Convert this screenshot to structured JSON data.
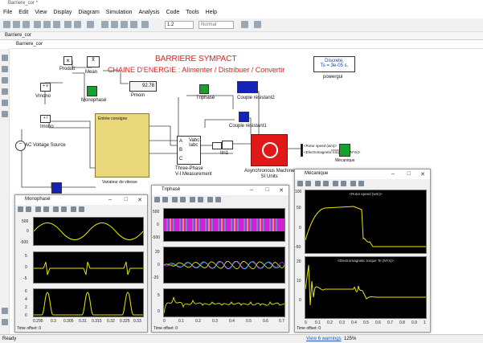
{
  "window": {
    "title": "Barriere_cor *"
  },
  "menu": [
    "File",
    "Edit",
    "View",
    "Display",
    "Diagram",
    "Simulation",
    "Analysis",
    "Code",
    "Tools",
    "Help"
  ],
  "toolbar": {
    "step_time": "1.2",
    "sim_mode": "Normal"
  },
  "tab": {
    "label": "Barriere_cor"
  },
  "breadcrumb": {
    "label": "Barriere_cor"
  },
  "model": {
    "title": "BARRIERE SYMPACT",
    "subtitle": "CHAINE D'ENERGIE : Alimenter / Distribuer / Convertir",
    "title_color": "#e02020",
    "powergui": {
      "text1": "Discrete,",
      "text2": "Ts = 3e-05 s.",
      "label": "powergui"
    },
    "blocks": {
      "produit": "Produit",
      "mean": "Mean",
      "display_value": "92.78",
      "pmoin": "Pmoin",
      "vmono": "Vmono",
      "imono": "Imono",
      "monophase": "Monophasé",
      "ac_source": "AC Voltage Source",
      "variateur": "Variateur de vitesse",
      "variateur_ports": "Entrée consigne",
      "triphase": "Triphasé",
      "vi_meas": "Three-Phase\nV-I Measurement",
      "vi_ports_left": [
        "A",
        "B",
        "C"
      ],
      "vi_ports_right": [
        "Vabc",
        "Iabc",
        "a",
        "b",
        "c"
      ],
      "itri1": "Itri1",
      "couple_resistant2": "Couple résistant2",
      "couple_resistant1": "Couple résistant1",
      "motor": "Asynchronous Machine\nSI Units",
      "bus_sel_1": "<Rotor speed (wm)>",
      "bus_sel_2": "<Electromagnetic torque Te (N*m)>",
      "mecanique": "Mécanique"
    }
  },
  "scopes": {
    "monophase": {
      "title": "Monophasé",
      "time_offset": "Time offset:  0",
      "y_ticks_1": [
        "500",
        "0",
        "-500"
      ],
      "y_ticks_2": [
        "5",
        "0",
        "-5"
      ],
      "y_ticks_3": [
        "6",
        "4",
        "2",
        "0"
      ],
      "x_ticks": [
        "0.295",
        "0.3",
        "0.305",
        "0.31",
        "0.315",
        "0.32",
        "0.325",
        "0.33"
      ]
    },
    "triphase": {
      "title": "Triphasé",
      "time_offset": "Time offset:  0",
      "y_ticks_1": [
        "500",
        "0",
        "-500"
      ],
      "y_ticks_2": [
        "20",
        "0",
        "-20"
      ],
      "y_ticks_3": [
        "5",
        "0"
      ],
      "x_ticks": [
        "0",
        "0.1",
        "0.2",
        "0.3",
        "0.4",
        "0.5",
        "0.6",
        "0.7"
      ]
    },
    "mecanique": {
      "title": "Mécanique",
      "time_offset": "Time offset:  0",
      "plot1_title": "<Rotor speed (wm)>",
      "plot2_title": "<Electromagnetic torque Te (N*m)>",
      "y_ticks_1": [
        "100",
        "50",
        "0",
        "-50"
      ],
      "y_ticks_2": [
        "20",
        "10",
        "0"
      ],
      "x_ticks": [
        "0",
        "0.1",
        "0.2",
        "0.3",
        "0.4",
        "0.5",
        "0.6",
        "0.7",
        "0.8",
        "0.9",
        "1"
      ]
    }
  },
  "status": {
    "left": "Ready",
    "warnings": "View 6 warnings",
    "zoom": "125%"
  },
  "colors": {
    "accent": "#e8e070",
    "scope_bg": "#000000",
    "trace": "#e8e800",
    "link": "#1e5fbf"
  }
}
